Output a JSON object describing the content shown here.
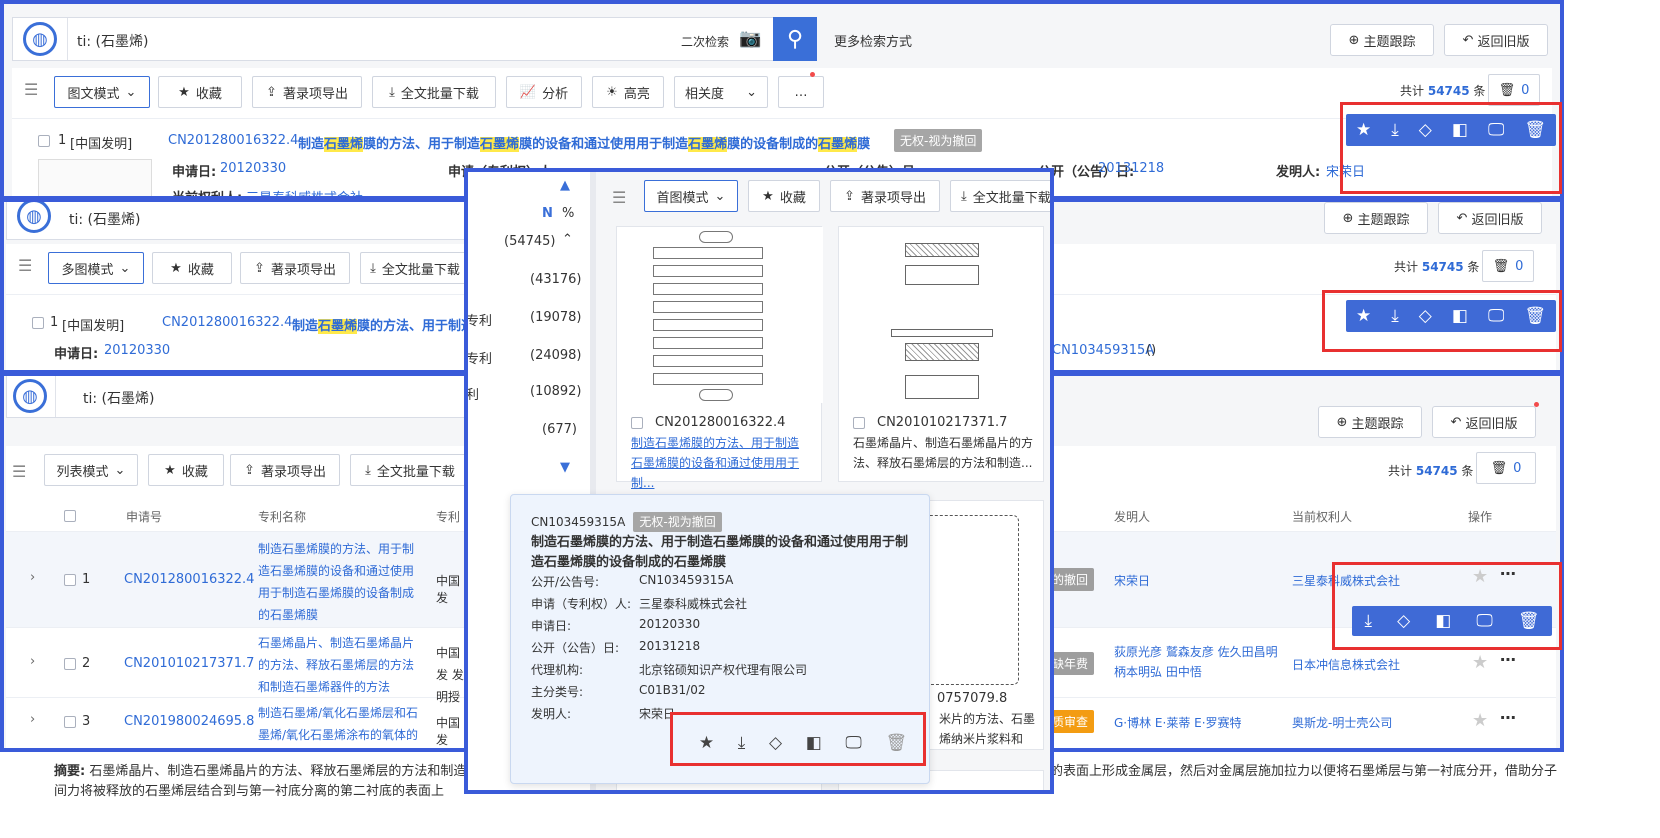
{
  "query": "ti: (石墨烯)",
  "top": {
    "second_search": "二次检索",
    "more_search": "更多检索方式",
    "topic_track": "主题跟踪",
    "back_old": "返回旧版"
  },
  "toolbar": {
    "mode_graphic": "图文模式",
    "mode_multi": "多图模式",
    "mode_list": "列表模式",
    "mode_first": "首图模式",
    "favorite": "收藏",
    "export": "著录项导出",
    "download": "全文批量下载",
    "analyze": "分析",
    "highlight": "高亮",
    "sort": "相关度",
    "more": "…",
    "total_prefix": "共计",
    "total": "54745",
    "total_suffix": "条",
    "trash_count": "0"
  },
  "record1": {
    "index": "1",
    "type": "[中国发明]",
    "no": "CN201280016322.4",
    "title_parts": [
      "制造",
      "石墨烯",
      "膜的方法、用于制造",
      "石墨烯",
      "膜的设备和通过使用用于制造",
      "石墨烯",
      "膜的设备制成的",
      "石墨烯",
      "膜"
    ],
    "status": "无权-视为撤回",
    "apply_date_label": "申请日:",
    "apply_date": "20120330",
    "applicant_label": "申请（专利权）人:",
    "applicant": "三星泰科威株式会社",
    "pub_no_label": "公开（公告）号:",
    "pub_no": "CN103459315A",
    "pub_date_label": "公开（公告）日:",
    "pub_date": "20131218",
    "inventor_label": "发明人:",
    "inventor": "宋荣日",
    "owner_label": "当前权利人:",
    "owner": "三星泰科威株式会社"
  },
  "sidebar": {
    "n": "N",
    "pct": "%",
    "counts": [
      "(54745)",
      "(43176)",
      "(19078)",
      "(24098)",
      "(10892)",
      "(677)"
    ],
    "labels": [
      "",
      "",
      "专利",
      "专利",
      "利",
      ""
    ]
  },
  "cards": [
    {
      "no": "CN201280016322.4",
      "title": "制造石墨烯膜的方法、用于制造石墨烯膜的设备和通过使用用于制..."
    },
    {
      "no": "CN201010217371.7",
      "title": "石墨烯晶片、制造石墨烯晶片的方法、释放石墨烯层的方法和制造..."
    },
    {
      "no": "0757079.8",
      "title": "米片的方法、石墨烯纳米片浆料和包..."
    }
  ],
  "popup": {
    "no": "CN103459315A",
    "status": "无权-视为撤回",
    "title": "制造石墨烯膜的方法、用于制造石墨烯膜的设备和通过使用用于制造石墨烯膜的设备制成的石墨烯膜",
    "fields": [
      {
        "k": "公开/公告号:",
        "v": "CN103459315A"
      },
      {
        "k": "申请（专利权）人:",
        "v": "三星泰科威株式会社"
      },
      {
        "k": "申请日:",
        "v": "20120330"
      },
      {
        "k": "公开（公告）日:",
        "v": "20131218"
      },
      {
        "k": "代理机构:",
        "v": "北京铭硕知识产权代理有限公司"
      },
      {
        "k": "主分类号:",
        "v": "C01B31/02"
      },
      {
        "k": "发明人:",
        "v": "宋荣日"
      }
    ]
  },
  "list": {
    "headers": [
      "申请号",
      "专利名称",
      "专利",
      "发明人",
      "当前权利人",
      "操作"
    ],
    "rows": [
      {
        "idx": "1",
        "no": "CN201280016322.4",
        "title": "制造石墨烯膜的方法、用于制造石墨烯膜的设备和通过使用用于制造石墨烯膜的设备制成的石墨烯膜",
        "type": "中国发",
        "status": "的撤回",
        "inventor": "宋荣日",
        "owner": "三星泰科威株式会社"
      },
      {
        "idx": "2",
        "no": "CN201010217371.7",
        "title": "石墨烯晶片、制造石墨烯晶片的方法、释放石墨烯层的方法和制造石墨烯器件的方法",
        "type": "中国发 发明授",
        "status": "缺年费",
        "inventor": "荻原光彦 鷲森友彦 佐久田昌明 柄本明弘 田中悟",
        "owner": "日本冲信息株式会社"
      },
      {
        "idx": "3",
        "no": "CN201980024695.8",
        "title": "制造石墨烯/氧化石墨烯层和石墨烯/氧化石墨烯涂布的氧体的方法",
        "type": "中国发",
        "status": "质审查",
        "inventor": "G·博林 E·莱蒂 E·罗赛特",
        "owner": "奥斯龙-明士壳公司"
      }
    ]
  },
  "abstract": {
    "label": "摘要:",
    "line1": "石墨烯晶片、制造石墨烯晶片的方法、释放石墨烯层的方法和制造石墨烯",
    "line1_tail": "的表面上形成金属层，然后对金属层施加拉力以便将石墨烯层与第一衬底分开，借助分子",
    "line2": "间力将被释放的石墨烯层结合到与第一衬底分离的第二衬底的表面上"
  }
}
